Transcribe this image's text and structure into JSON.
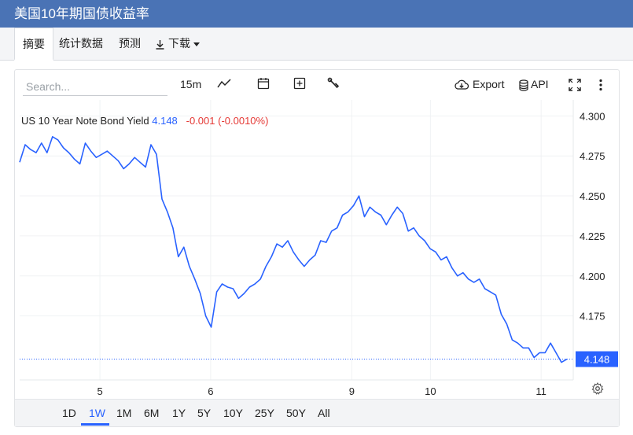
{
  "header": {
    "title": "美国10年期国债收益率"
  },
  "tabs": [
    {
      "label": "摘要",
      "active": true
    },
    {
      "label": "统计数据",
      "active": false
    },
    {
      "label": "预测",
      "active": false
    },
    {
      "label": "下载",
      "active": false
    }
  ],
  "toolbar": {
    "search_placeholder": "Search...",
    "interval": "15m",
    "export_label": "Export",
    "api_label": "API"
  },
  "legend": {
    "symbol": "US 10 Year Note Bond Yield",
    "price": "4.148",
    "change": "-0.001 (-0.0010%)"
  },
  "ranges": [
    "1D",
    "1W",
    "1M",
    "6M",
    "1Y",
    "5Y",
    "10Y",
    "25Y",
    "50Y",
    "All"
  ],
  "active_range": "1W",
  "colors": {
    "line": "#2962ff",
    "header": "#4a73b5",
    "last_price_bg": "#2962ff",
    "change": "#e53935"
  },
  "chart_data": {
    "type": "line",
    "series": [
      {
        "name": "US 10 Year Note Bond Yield",
        "values": [
          4.271,
          4.282,
          4.279,
          4.277,
          4.283,
          4.277,
          4.287,
          4.285,
          4.28,
          4.277,
          4.273,
          4.27,
          4.283,
          4.278,
          4.274,
          4.276,
          4.278,
          4.275,
          4.272,
          4.267,
          4.27,
          4.274,
          4.271,
          4.268,
          4.282,
          4.276,
          4.248,
          4.24,
          4.23,
          4.212,
          4.218,
          4.206,
          4.198,
          4.189,
          4.175,
          4.168,
          4.19,
          4.195,
          4.193,
          4.192,
          4.186,
          4.189,
          4.193,
          4.195,
          4.198,
          4.206,
          4.212,
          4.22,
          4.218,
          4.222,
          4.215,
          4.21,
          4.206,
          4.21,
          4.213,
          4.222,
          4.221,
          4.228,
          4.23,
          4.238,
          4.24,
          4.244,
          4.25,
          4.237,
          4.243,
          4.24,
          4.238,
          4.232,
          4.238,
          4.243,
          4.239,
          4.228,
          4.23,
          4.225,
          4.222,
          4.217,
          4.215,
          4.21,
          4.212,
          4.205,
          4.2,
          4.202,
          4.198,
          4.196,
          4.198,
          4.192,
          4.19,
          4.188,
          4.176,
          4.17,
          4.16,
          4.158,
          4.155,
          4.155,
          4.149,
          4.152,
          4.152,
          4.158,
          4.152,
          4.146,
          4.148
        ],
        "last_value": 4.148
      }
    ],
    "x_tick_labels": [
      "5",
      "6",
      "9",
      "10",
      "11"
    ],
    "y_tick_labels": [
      "4.300",
      "4.275",
      "4.250",
      "4.225",
      "4.200",
      "4.175"
    ],
    "ylim": [
      4.135,
      4.31
    ],
    "grid": true
  }
}
